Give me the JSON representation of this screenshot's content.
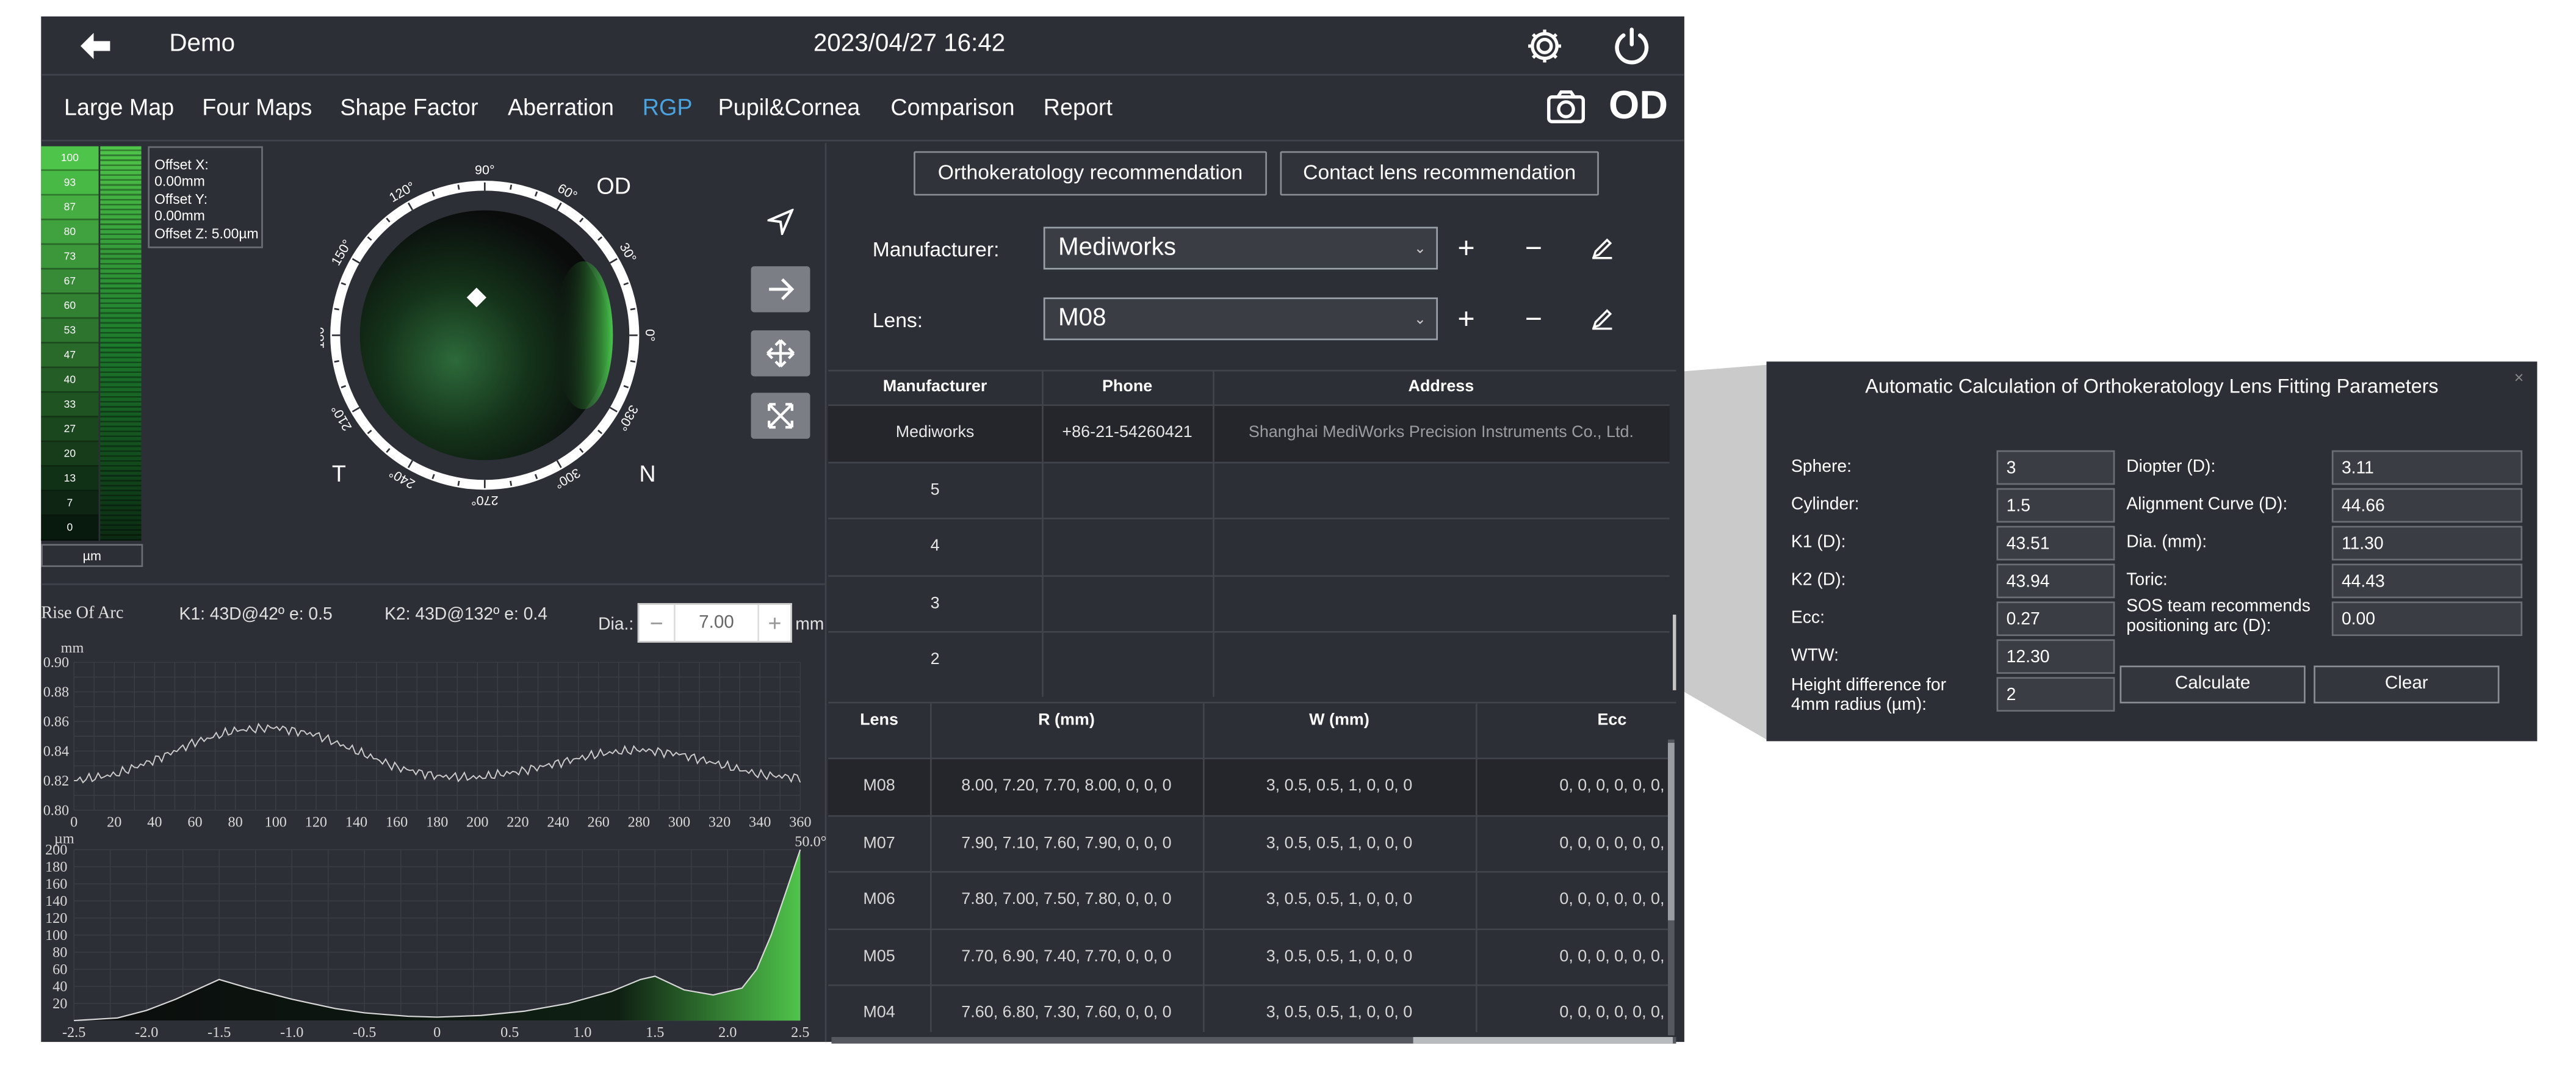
{
  "header": {
    "title": "Demo",
    "datetime": "2023/04/27 16:42",
    "eye": "OD"
  },
  "nav": {
    "tabs": [
      {
        "label": "Large Map",
        "active": false
      },
      {
        "label": "Four Maps",
        "active": false
      },
      {
        "label": "Shape Factor",
        "active": false
      },
      {
        "label": "Aberration",
        "active": false
      },
      {
        "label": "RGP",
        "active": true
      },
      {
        "label": "Pupil&Cornea",
        "active": false
      },
      {
        "label": "Comparison",
        "active": false
      },
      {
        "label": "Report",
        "active": false
      }
    ],
    "active_color": "#4aa3df"
  },
  "colorscale": {
    "values": [
      "100",
      "93",
      "87",
      "80",
      "73",
      "67",
      "60",
      "53",
      "47",
      "40",
      "33",
      "27",
      "20",
      "13",
      "7",
      "0"
    ],
    "unit": "µm"
  },
  "offsets": {
    "x": "Offset X: 0.00mm",
    "y": "Offset Y: 0.00mm",
    "z": "Offset Z: 5.00µm"
  },
  "dial": {
    "eye_label": "OD",
    "left_label": "T",
    "right_label": "N",
    "angles": [
      "0°",
      "30°",
      "60°",
      "90°",
      "120°",
      "150°",
      "180°",
      "210°",
      "240°",
      "270°",
      "300°",
      "330°"
    ]
  },
  "arc": {
    "title": "Rise Of Arc",
    "k1": "K1: 43D@42º e: 0.5",
    "k2": "K2: 43D@132º e: 0.4",
    "dia_label": "Dia.:",
    "dia_value": "7.00",
    "dia_unit": "mm",
    "minus": "−",
    "plus": "+"
  },
  "chart_data": [
    {
      "type": "line",
      "ylabel": "mm",
      "x_ticks": [
        "0",
        "20",
        "40",
        "60",
        "80",
        "100",
        "120",
        "140",
        "160",
        "180",
        "200",
        "220",
        "240",
        "260",
        "280",
        "300",
        "320",
        "340",
        "360"
      ],
      "y_ticks": [
        "0.90",
        "0.88",
        "0.86",
        "0.84",
        "0.82",
        "0.80"
      ],
      "xlim": [
        0,
        360
      ],
      "ylim": [
        0.8,
        0.9
      ],
      "grid": true,
      "series": [
        {
          "x": [
            0,
            20,
            40,
            60,
            80,
            100,
            120,
            140,
            160,
            180,
            200,
            220,
            240,
            260,
            280,
            300,
            320,
            340,
            360
          ],
          "y": [
            0.82,
            0.824,
            0.834,
            0.846,
            0.854,
            0.856,
            0.851,
            0.84,
            0.829,
            0.823,
            0.822,
            0.826,
            0.832,
            0.838,
            0.841,
            0.838,
            0.831,
            0.824,
            0.822
          ]
        }
      ]
    },
    {
      "type": "area",
      "ylabel": "µm",
      "corner_label": "50.0°",
      "x_ticks": [
        "-2.5",
        "-2.0",
        "-1.5",
        "-1.0",
        "-0.5",
        "0",
        "0.5",
        "1.0",
        "1.5",
        "2.0",
        "2.5"
      ],
      "y_ticks": [
        "200",
        "180",
        "160",
        "140",
        "120",
        "100",
        "80",
        "60",
        "40",
        "20"
      ],
      "xlim": [
        -2.5,
        2.5
      ],
      "ylim": [
        0,
        200
      ],
      "grid": true,
      "series": [
        {
          "x": [
            -2.5,
            -2.2,
            -2.0,
            -1.8,
            -1.5,
            -1.3,
            -1.0,
            -0.7,
            -0.5,
            -0.2,
            0,
            0.3,
            0.6,
            0.9,
            1.2,
            1.4,
            1.5,
            1.7,
            1.9,
            2.1,
            2.2,
            2.3,
            2.4,
            2.5
          ],
          "y": [
            0,
            3,
            12,
            25,
            48,
            38,
            25,
            14,
            9,
            5,
            4,
            6,
            11,
            20,
            34,
            48,
            52,
            36,
            30,
            38,
            60,
            100,
            150,
            200
          ]
        }
      ]
    }
  ],
  "recommend": {
    "ortho": "Orthokeratology recommendation",
    "contact": "Contact lens recommendation"
  },
  "form": {
    "manufacturer_label": "Manufacturer:",
    "manufacturer_value": "Mediworks",
    "lens_label": "Lens:",
    "lens_value": "M08"
  },
  "mfr_table": {
    "headers": [
      "Manufacturer",
      "Phone",
      "Address"
    ],
    "rows": [
      [
        "Mediworks",
        "+86-21-54260421",
        "Shanghai MediWorks Precision Instruments Co., Ltd."
      ],
      [
        "5",
        "",
        ""
      ],
      [
        "4",
        "",
        ""
      ],
      [
        "3",
        "",
        ""
      ],
      [
        "2",
        "",
        ""
      ]
    ]
  },
  "lens_table": {
    "headers": [
      "Lens",
      "R (mm)",
      "W (mm)",
      "Ecc"
    ],
    "rows": [
      [
        "M08",
        "8.00, 7.20, 7.70, 8.00, 0, 0, 0",
        "3, 0.5, 0.5, 1, 0, 0, 0",
        "0, 0, 0, 0, 0, 0,"
      ],
      [
        "M07",
        "7.90, 7.10, 7.60, 7.90, 0, 0, 0",
        "3, 0.5, 0.5, 1, 0, 0, 0",
        "0, 0, 0, 0, 0, 0,"
      ],
      [
        "M06",
        "7.80, 7.00, 7.50, 7.80, 0, 0, 0",
        "3, 0.5, 0.5, 1, 0, 0, 0",
        "0, 0, 0, 0, 0, 0,"
      ],
      [
        "M05",
        "7.70, 6.90, 7.40, 7.70, 0, 0, 0",
        "3, 0.5, 0.5, 1, 0, 0, 0",
        "0, 0, 0, 0, 0, 0,"
      ],
      [
        "M04",
        "7.60, 6.80, 7.30, 7.60, 0, 0, 0",
        "3, 0.5, 0.5, 1, 0, 0, 0",
        "0, 0, 0, 0, 0, 0,"
      ]
    ]
  },
  "dialog": {
    "title": "Automatic Calculation of Orthokeratology Lens Fitting Parameters",
    "close": "×",
    "left_fields": [
      {
        "label": "Sphere:",
        "value": "3"
      },
      {
        "label": "Cylinder:",
        "value": "1.5"
      },
      {
        "label": "K1 (D):",
        "value": "43.51"
      },
      {
        "label": "K2 (D):",
        "value": "43.94"
      },
      {
        "label": "Ecc:",
        "value": "0.27"
      },
      {
        "label": "WTW:",
        "value": "12.30"
      },
      {
        "label": "Height difference for 4mm radius (µm):",
        "value": "2"
      }
    ],
    "right_fields": [
      {
        "label": "Diopter (D):",
        "value": "3.11"
      },
      {
        "label": "Alignment Curve (D):",
        "value": "44.66"
      },
      {
        "label": "Dia. (mm):",
        "value": "11.30"
      },
      {
        "label": "Toric:",
        "value": "44.43"
      },
      {
        "label": "SOS team recommends positioning arc (D):",
        "value": "0.00"
      }
    ],
    "calculate": "Calculate",
    "clear": "Clear"
  }
}
